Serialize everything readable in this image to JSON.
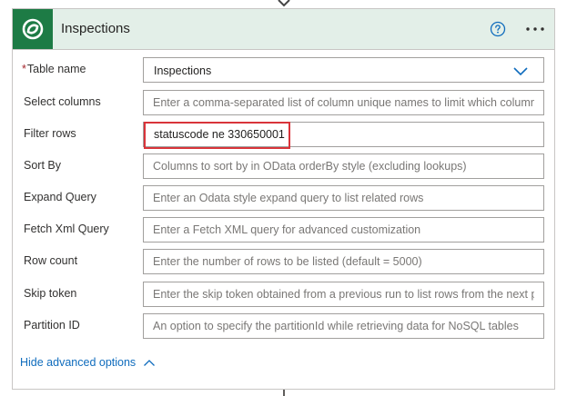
{
  "card": {
    "title": "Inspections",
    "help_icon": "help-circle-icon",
    "more_icon": "more-ellipsis-icon",
    "logo_icon": "dataverse-icon"
  },
  "fields": {
    "table_name": {
      "label": "Table name",
      "required_mark": "*",
      "value": "Inspections"
    },
    "select_columns": {
      "label": "Select columns",
      "placeholder": "Enter a comma-separated list of column unique names to limit which columns a"
    },
    "filter_rows": {
      "label": "Filter rows",
      "value": "statuscode ne 330650001"
    },
    "sort_by": {
      "label": "Sort By",
      "placeholder": "Columns to sort by in OData orderBy style (excluding lookups)"
    },
    "expand_query": {
      "label": "Expand Query",
      "placeholder": "Enter an Odata style expand query to list related rows"
    },
    "fetch_xml": {
      "label": "Fetch Xml Query",
      "placeholder": "Enter a Fetch XML query for advanced customization"
    },
    "row_count": {
      "label": "Row count",
      "placeholder": "Enter the number of rows to be listed (default = 5000)"
    },
    "skip_token": {
      "label": "Skip token",
      "placeholder": "Enter the skip token obtained from a previous run to list rows from the next pag"
    },
    "partition_id": {
      "label": "Partition ID",
      "placeholder": "An option to specify the partitionId while retrieving data for NoSQL tables"
    }
  },
  "advanced": {
    "label": "Hide advanced options"
  },
  "colors": {
    "header_bg": "#e3efe8",
    "logo_bg": "#1d7b45",
    "link": "#0f6cbd",
    "highlight": "#d9343a"
  }
}
